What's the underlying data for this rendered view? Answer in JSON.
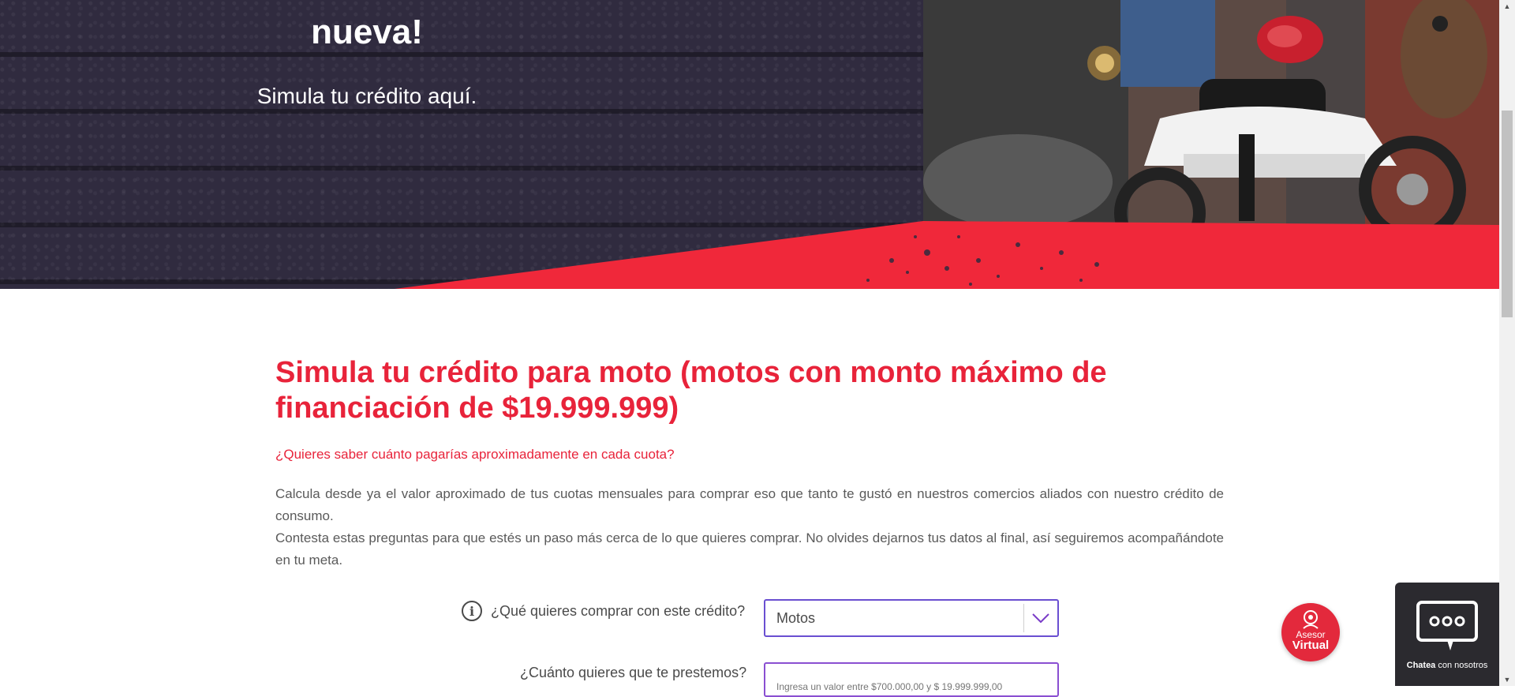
{
  "hero": {
    "title": "nueva!",
    "subtitle": "Simula tu crédito aquí."
  },
  "main": {
    "heading": "Simula tu crédito para moto (motos con monto máximo de financiación de $19.999.999)",
    "lead_question": "¿Quieres saber cuánto pagarías aproximadamente en cada cuota?",
    "paragraph_1": "Calcula desde ya el valor aproximado de tus cuotas mensuales para comprar eso que tanto te gustó en nuestros comercios aliados con nuestro crédito de consumo.",
    "paragraph_2": "Contesta estas preguntas para que estés un paso más cerca de lo que quieres comprar. No olvides dejarnos tus datos al final, así seguiremos acompañándote en tu meta."
  },
  "form": {
    "q1_label": "¿Qué quieres comprar con este crédito?",
    "q1_value": "Motos",
    "q2_label": "¿Cuánto quieres que te prestemos?",
    "q2_placeholder": "Ingresa un valor entre $700.000,00 y $ 19.999.999,00"
  },
  "chat": {
    "asesor_line1": "Asesor",
    "asesor_line2": "Virtual",
    "chatea_bold": "Chatea",
    "chatea_rest": " con nosotros"
  },
  "colors": {
    "brand_red": "#e8233a",
    "hero_dark": "#302b3f",
    "select_border": "#6a4fd1"
  },
  "icons": [
    "info-icon",
    "chevron-down-icon",
    "advisor-icon",
    "chat-bubble-icon"
  ]
}
